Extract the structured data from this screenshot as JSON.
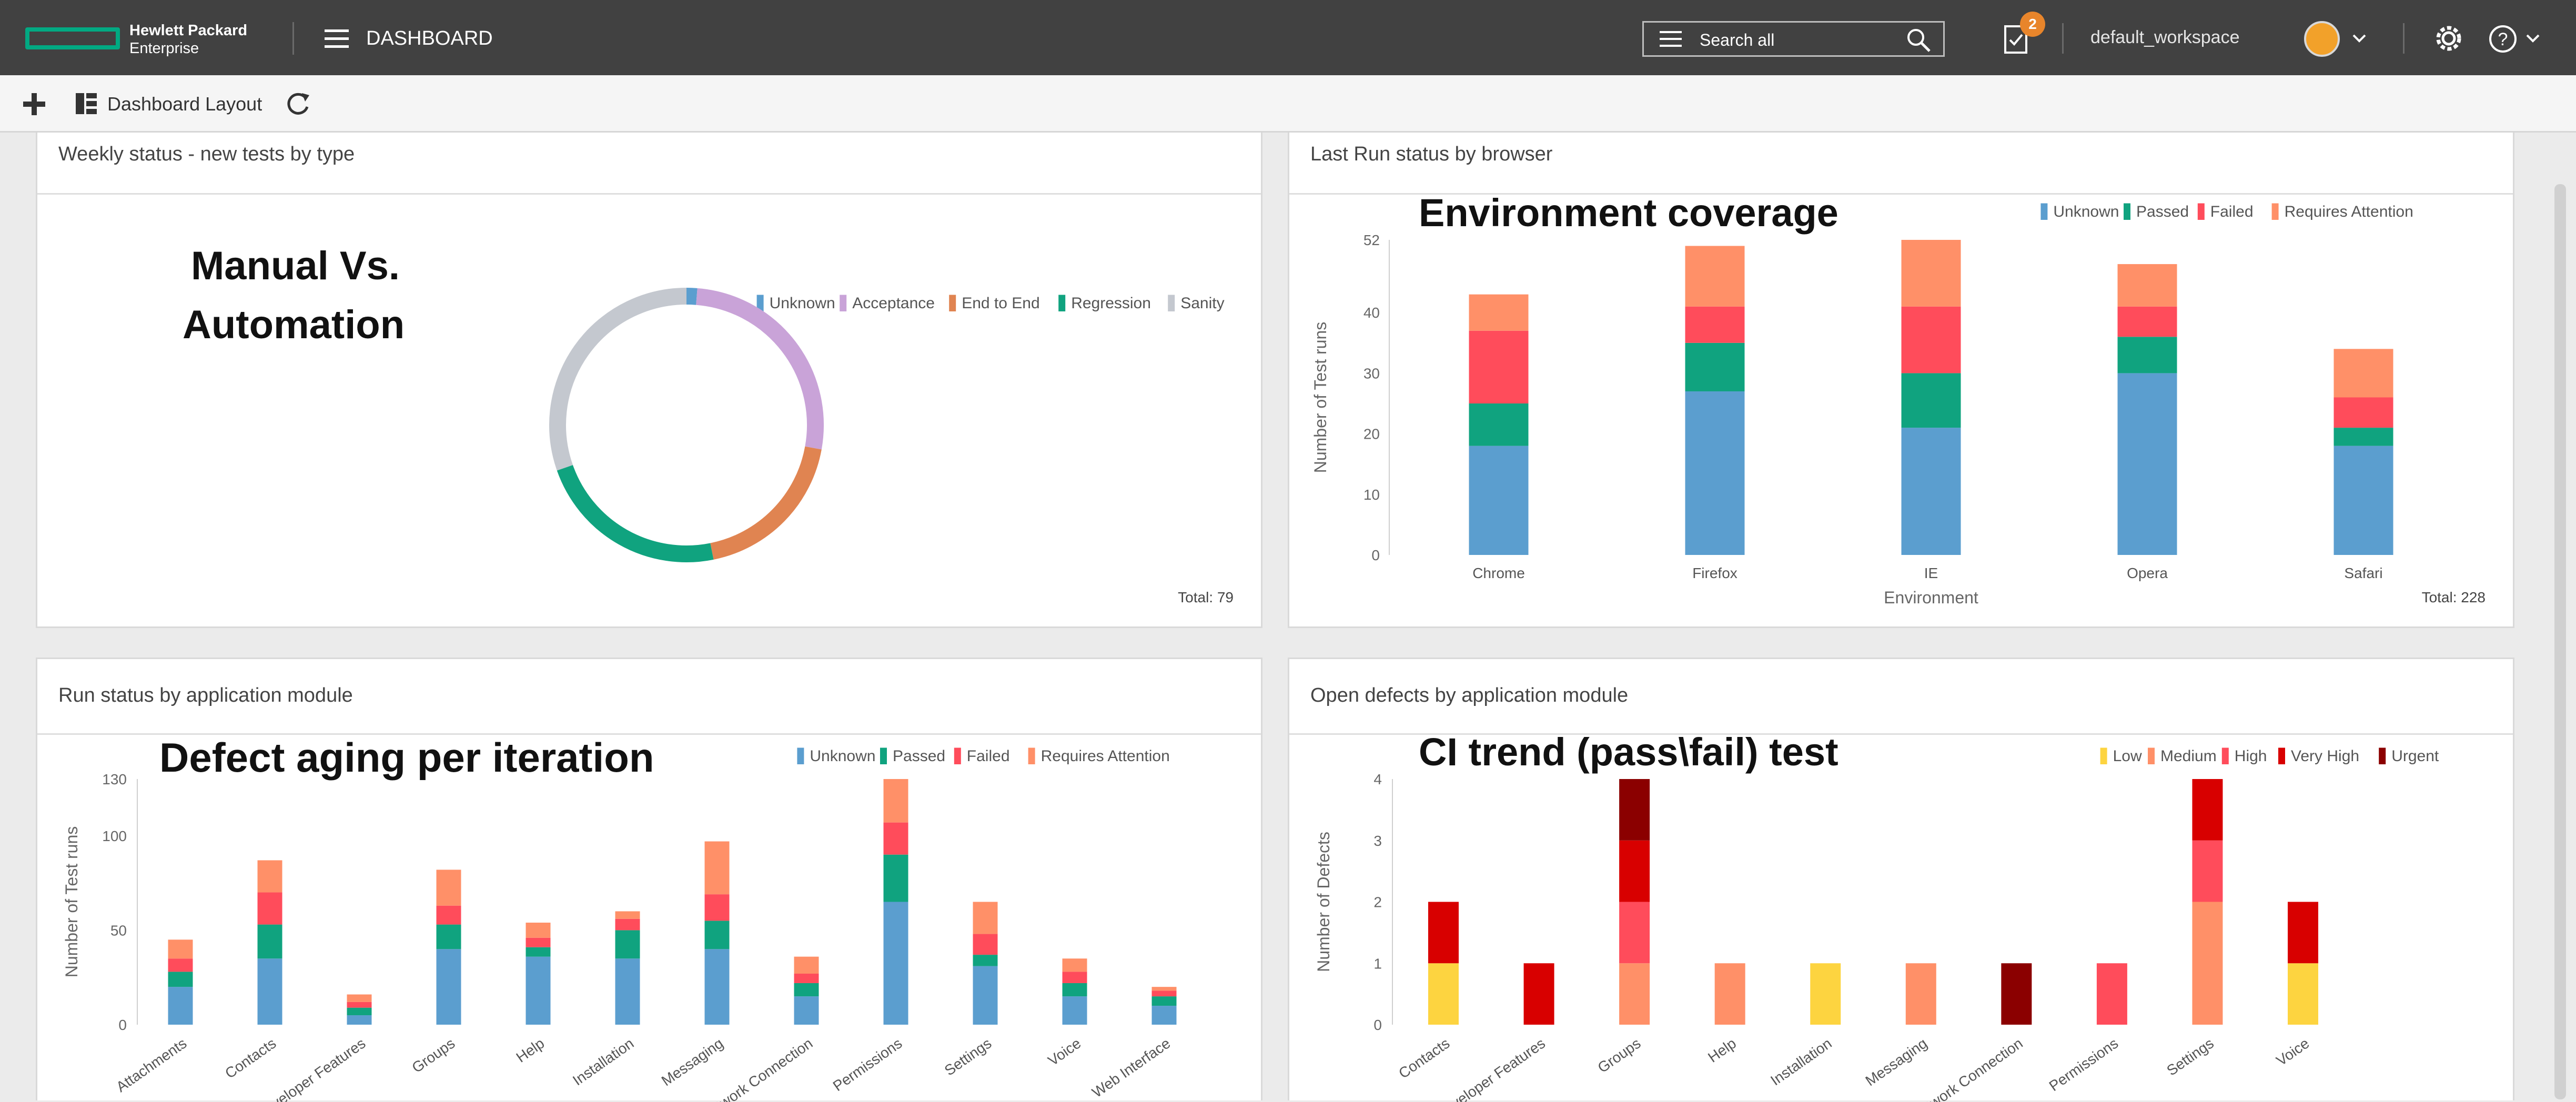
{
  "header": {
    "brand_line1": "Hewlett Packard",
    "brand_line2": "Enterprise",
    "title": "DASHBOARD",
    "search_placeholder": "Search all",
    "notification_count": "2",
    "workspace": "default_workspace",
    "icons": [
      "hpe-logo-icon",
      "menu-icon",
      "search-icon",
      "tasks-icon",
      "chevron-down-icon",
      "gear-icon",
      "help-icon"
    ]
  },
  "toolbar": {
    "layout_label": "Dashboard Layout",
    "icons": [
      "plus-icon",
      "layout-icon",
      "refresh-icon"
    ]
  },
  "panels": {
    "weekly": {
      "title": "Weekly status - new tests by type",
      "overlay_line1": "Manual Vs.",
      "overlay_line2": "Automation",
      "total": "Total: 79"
    },
    "browser": {
      "title": "Last Run status by browser",
      "overlay": "Environment coverage",
      "total": "Total: 228"
    },
    "module_runs": {
      "title": "Run status by application module",
      "overlay": "Defect aging per iteration"
    },
    "defects": {
      "title": "Open defects by application module",
      "overlay": "CI trend (pass\\fail) test"
    }
  },
  "colors": {
    "unknown": "#5b9ecf",
    "acceptance": "#c9a3d8",
    "end_to_end": "#e08451",
    "regression": "#10a37f",
    "sanity": "#c4c8cf",
    "passed": "#10a37f",
    "failed": "#ff4c5b",
    "requires_attention": "#ff9068",
    "low": "#fdd440",
    "medium": "#ff9068",
    "high": "#ff4c5b",
    "very_high": "#d80000",
    "urgent": "#8b0000"
  },
  "chart_data": [
    {
      "id": "weekly",
      "type": "pie",
      "legend": [
        "Unknown",
        "Acceptance",
        "End to End",
        "Regression",
        "Sanity"
      ],
      "values": [
        1,
        21,
        15,
        18,
        24
      ],
      "legend_placement": "top-right"
    },
    {
      "id": "browser",
      "type": "bar",
      "stacked": true,
      "categories": [
        "Chrome",
        "Firefox",
        "IE",
        "Opera",
        "Safari"
      ],
      "xlabel": "Environment",
      "ylabel": "Number of Test runs",
      "yticks": [
        0,
        10,
        20,
        30,
        40,
        52
      ],
      "ylim": [
        0,
        52
      ],
      "series": [
        {
          "name": "Unknown",
          "values": [
            18,
            27,
            21,
            30,
            18
          ]
        },
        {
          "name": "Passed",
          "values": [
            7,
            8,
            9,
            6,
            3
          ]
        },
        {
          "name": "Failed",
          "values": [
            12,
            6,
            11,
            5,
            5
          ]
        },
        {
          "name": "Requires Attention",
          "values": [
            6,
            10,
            11,
            7,
            8
          ]
        }
      ],
      "legend_placement": "top-right"
    },
    {
      "id": "module_runs",
      "type": "bar",
      "stacked": true,
      "categories": [
        "Attachments",
        "Contacts",
        "Developer Features",
        "Groups",
        "Help",
        "Installation",
        "Messaging",
        "Network Connection",
        "Permissions",
        "Settings",
        "Voice",
        "Web Interface"
      ],
      "ylabel": "Number of Test runs",
      "yticks": [
        0,
        50,
        100,
        130
      ],
      "ylim": [
        0,
        130
      ],
      "series": [
        {
          "name": "Unknown",
          "values": [
            20,
            35,
            5,
            40,
            36,
            35,
            40,
            15,
            65,
            31,
            15,
            10
          ]
        },
        {
          "name": "Passed",
          "values": [
            8,
            18,
            4,
            13,
            5,
            15,
            15,
            7,
            25,
            6,
            7,
            5
          ]
        },
        {
          "name": "Failed",
          "values": [
            7,
            17,
            3,
            10,
            5,
            6,
            14,
            5,
            17,
            11,
            6,
            3
          ]
        },
        {
          "name": "Requires Attention",
          "values": [
            10,
            17,
            4,
            19,
            8,
            4,
            28,
            9,
            23,
            17,
            7,
            2
          ]
        }
      ],
      "legend_placement": "top-right"
    },
    {
      "id": "defects",
      "type": "bar",
      "stacked": true,
      "categories": [
        "Contacts",
        "Developer Features",
        "Groups",
        "Help",
        "Installation",
        "Messaging",
        "Network Connection",
        "Permissions",
        "Settings",
        "Voice"
      ],
      "ylabel": "Number of Defects",
      "yticks": [
        0,
        1,
        2,
        3,
        4
      ],
      "ylim": [
        0,
        4
      ],
      "series": [
        {
          "name": "Low",
          "values": [
            1,
            0,
            0,
            0,
            1,
            0,
            0,
            0,
            0,
            1
          ]
        },
        {
          "name": "Medium",
          "values": [
            0,
            0,
            1,
            1,
            0,
            1,
            0,
            0,
            2,
            0
          ]
        },
        {
          "name": "High",
          "values": [
            0,
            0,
            1,
            0,
            0,
            0,
            0,
            1,
            1,
            0
          ]
        },
        {
          "name": "Very High",
          "values": [
            1,
            1,
            1,
            0,
            0,
            0,
            0,
            0,
            1,
            1
          ]
        },
        {
          "name": "Urgent",
          "values": [
            0,
            0,
            1,
            0,
            0,
            0,
            1,
            0,
            0,
            0
          ]
        }
      ],
      "legend_placement": "top-right"
    }
  ]
}
